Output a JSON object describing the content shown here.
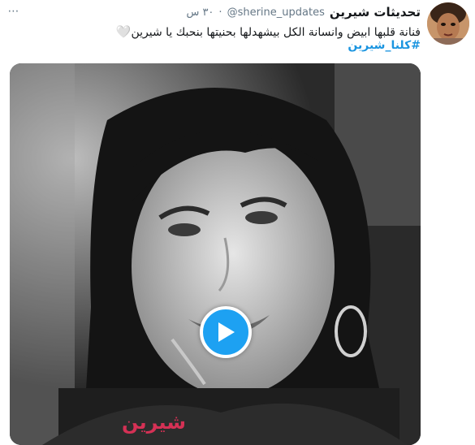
{
  "tweet": {
    "display_name": "تحديثات شيرين",
    "handle": "@sherine_updates",
    "separator": "·",
    "time": "٣٠ س",
    "text": "فنانة قلبها ابيض وانسانة الكل بيشهدلها بحنيتها بنحبك يا شيرين",
    "heart": "🤍",
    "hashtag": "#كلنا_شيرين",
    "more_icon": "⋯"
  },
  "media": {
    "type": "video",
    "play_icon": "play-icon",
    "overlay_text": "شيرين"
  },
  "colors": {
    "accent": "#1da1f2",
    "hashtag": "#1b95e0",
    "secondary_text": "#657786"
  }
}
